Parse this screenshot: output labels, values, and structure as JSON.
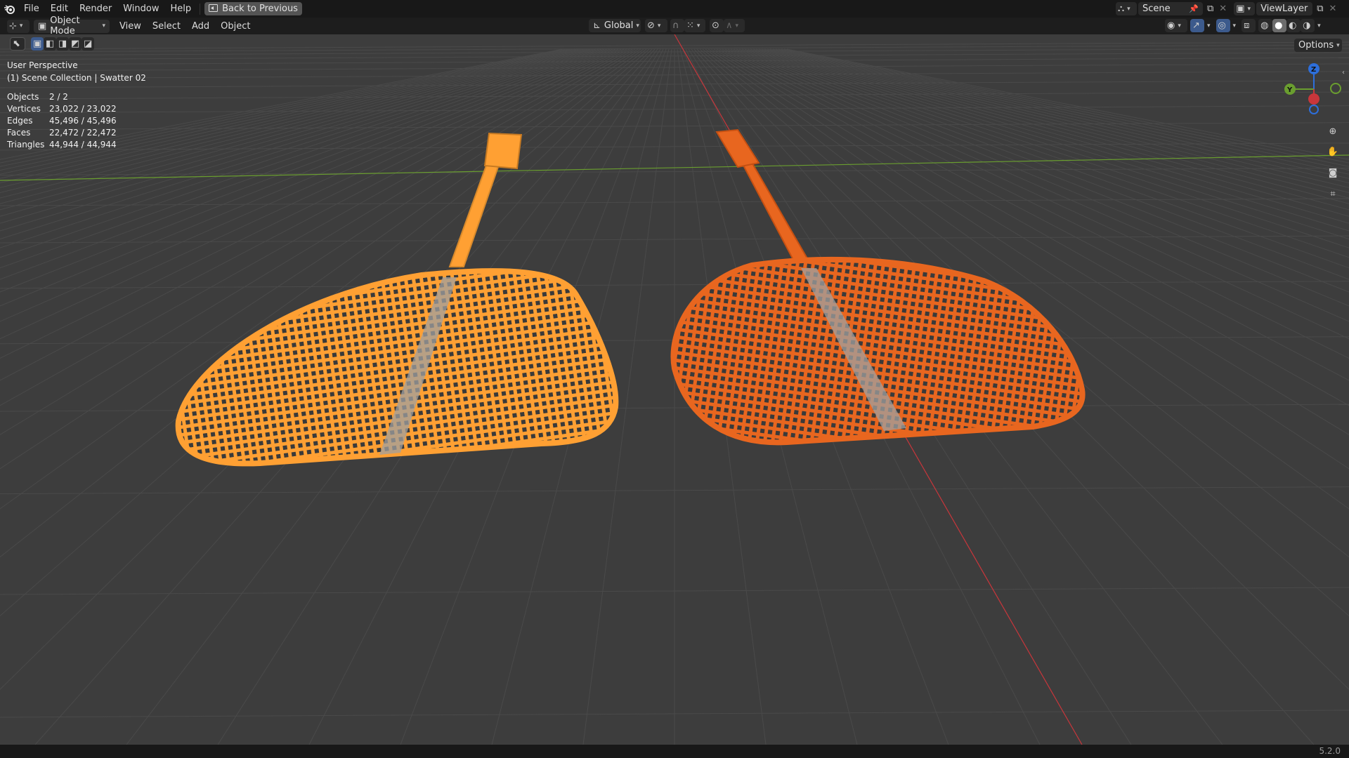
{
  "topbar": {
    "logo_icon": "blender-logo-icon",
    "menus": [
      "File",
      "Edit",
      "Render",
      "Window",
      "Help"
    ],
    "back_button": "Back to Previous",
    "scene_name": "Scene",
    "view_layer": "ViewLayer"
  },
  "header": {
    "mode": "Object Mode",
    "menus": [
      "View",
      "Select",
      "Add",
      "Object"
    ],
    "transform_orientation": "Global",
    "options_label": "Options"
  },
  "viewport": {
    "perspective": "User Perspective",
    "collection": "(1) Scene Collection | Swatter 02",
    "stats": [
      {
        "label": "Objects",
        "value": "2 / 2"
      },
      {
        "label": "Vertices",
        "value": "23,022 / 23,022"
      },
      {
        "label": "Edges",
        "value": "45,496 / 45,496"
      },
      {
        "label": "Faces",
        "value": "22,472 / 22,472"
      },
      {
        "label": "Triangles",
        "value": "44,944 / 44,944"
      }
    ],
    "gizmo": {
      "z": "Z",
      "y": "Y"
    },
    "colors": {
      "selected_object": "#ffa033",
      "active_object": "#e8661f",
      "x_axis": "#c8363b",
      "y_axis": "#6a9e2f",
      "background": "#3d3d3d"
    }
  },
  "statusbar": {
    "version": "5.2.0"
  }
}
